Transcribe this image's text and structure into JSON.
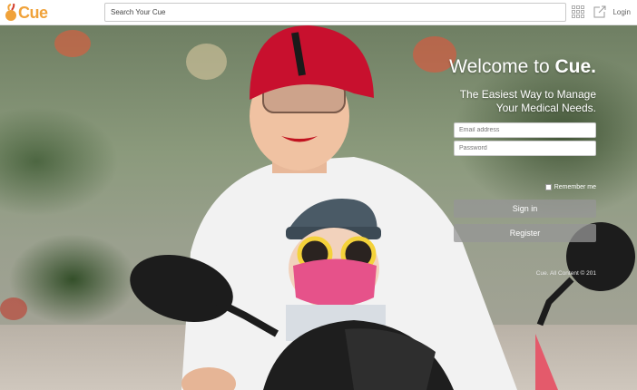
{
  "app": {
    "logo_text": "Cue"
  },
  "search": {
    "placeholder": "Search Your Cue"
  },
  "header": {
    "login_label": "Login"
  },
  "hero": {
    "welcome_prefix": "Welcome to ",
    "welcome_brand": "Cue.",
    "tagline_line1": "The Easiest Way to Manage",
    "tagline_line2": "Your Medical Needs."
  },
  "form": {
    "email_placeholder": "Email address",
    "password_placeholder": "Password",
    "remember_label": "Remember me",
    "signin_label": "Sign in",
    "register_label": "Register"
  },
  "footer": {
    "copyright": "Cue. All Content © 201"
  },
  "colors": {
    "brand_orange": "#f0a23a",
    "button_gray": "#969696"
  }
}
